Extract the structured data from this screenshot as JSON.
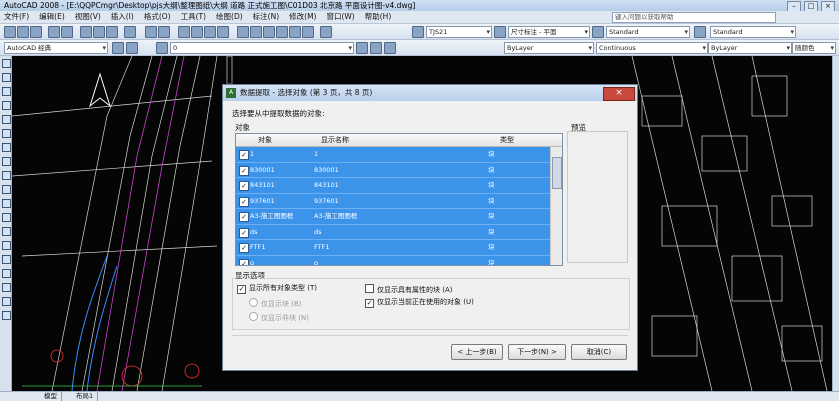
{
  "window": {
    "title": "AutoCAD 2008 - [E:\\QQPCmgr\\Desktop\\pjs大纲\\整理图纸\\大纲 道路 正式施工图\\C01D03 北京路 平面设计图-v4.dwg]",
    "min": "–",
    "max": "□",
    "close": "×"
  },
  "menu": {
    "items": [
      "文件(F)",
      "编辑(E)",
      "视图(V)",
      "插入(I)",
      "格式(O)",
      "工具(T)",
      "绘图(D)",
      "标注(N)",
      "修改(M)",
      "窗口(W)",
      "帮助(H)"
    ],
    "help_search": "键入问题以获取帮助"
  },
  "toolbar1": {
    "text_style": "TJS21",
    "dim_style": "尺寸标注 - 平面",
    "table_style": "Standard",
    "ml_style": "Standard"
  },
  "toolbar2": {
    "workspace": "AutoCAD 经典",
    "layer": "0",
    "color": "ByLayer",
    "linetype": "Continuous",
    "lineweight": "ByLayer",
    "plot_style": "随颜色"
  },
  "statusbar": {
    "tabs": [
      "模型",
      "布局1"
    ]
  },
  "dialog": {
    "title": "数据提取 - 选择对象 (第 3 页，共 8 页)",
    "instruction": "选择要从中提取数据的对象:",
    "group_label": "对象",
    "preview_label": "预览",
    "columns": [
      "对象",
      "显示名称",
      "类型"
    ],
    "rows": [
      {
        "obj": "1",
        "name": "1",
        "type": "块"
      },
      {
        "obj": "830001",
        "name": "830001",
        "type": "块"
      },
      {
        "obj": "843101",
        "name": "843101",
        "type": "块"
      },
      {
        "obj": "937601",
        "name": "937601",
        "type": "块"
      },
      {
        "obj": "A3-施工图图框",
        "name": "A3-施工图图框",
        "type": "块"
      },
      {
        "obj": "ds",
        "name": "ds",
        "type": "块"
      },
      {
        "obj": "FTF1",
        "name": "FTF1",
        "type": "块"
      },
      {
        "obj": "g",
        "name": "g",
        "type": "块"
      }
    ],
    "checkmark": "✓",
    "options_label": "显示选项",
    "opt_all_types": "显示所有对象类型 (T)",
    "opt_blocks_only": "仅显示块 (B)",
    "opt_nonblocks_only": "仅显示非块 (N)",
    "opt_attr_blocks": "仅显示具有属性的块 (A)",
    "opt_in_use": "仅显示当前正在使用的对象 (U)",
    "buttons": {
      "back": "< 上一步(B)",
      "next": "下一步(N) >",
      "cancel": "取消(C)"
    }
  }
}
